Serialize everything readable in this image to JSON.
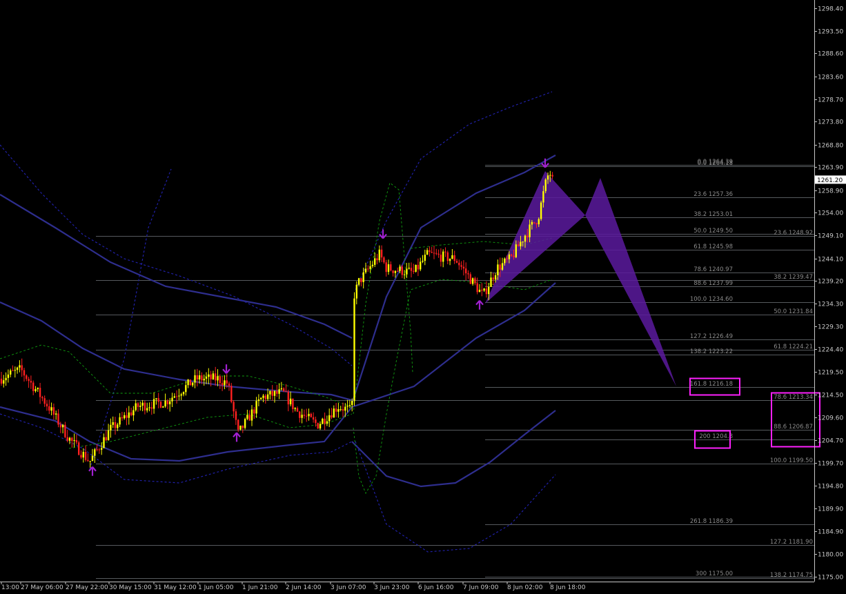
{
  "colors": {
    "background": "#000000",
    "axis": "#c8c8c8",
    "text": "#c8c8c8",
    "fib_line": "#9aa0a8",
    "fib_text": "#8a8a8a",
    "bull_candle": "#ffff00",
    "bear_candle": "#ff2020",
    "band_solid": "#2e2e8e",
    "band_dotted": "#2020a8",
    "band_green": "#10a010",
    "pattern": "#5a1a9e",
    "arrow_up": "#a020d0",
    "arrow_down": "#a020d0",
    "highlight_box": "#ff20ff",
    "price_box_bg": "#ffffff",
    "price_box_text": "#000000"
  },
  "chart_data": {
    "type": "candlestick",
    "ylim": [
      1175.0,
      1300.0
    ],
    "price_ticks": [
      "1298.40",
      "1293.50",
      "1288.60",
      "1283.60",
      "1278.70",
      "1273.80",
      "1268.80",
      "1263.90",
      "1258.90",
      "1254.00",
      "1249.10",
      "1244.10",
      "1239.20",
      "1234.30",
      "1229.30",
      "1224.40",
      "1219.50",
      "1214.50",
      "1209.60",
      "1204.70",
      "1199.70",
      "1194.80",
      "1189.90",
      "1184.90",
      "1180.00",
      "1175.00"
    ],
    "current_price": "1261.20",
    "time_labels": [
      "13:00",
      "27 May 06:00",
      "27 May 22:00",
      "30 May 15:00",
      "31 May 12:00",
      "1 Jun 05:00",
      "1 Jun 21:00",
      "2 Jun 14:00",
      "3 Jun 07:00",
      "3 Jun 23:00",
      "6 Jun 16:00",
      "7 Jun 09:00",
      "8 Jun 02:00",
      "8 Jun 18:00"
    ],
    "fib_levels": [
      {
        "label": "0.0 1264.39",
        "price": 1264.39,
        "x_start": "8 Jun 02:00",
        "x_end": "right"
      },
      {
        "label": "0.0 1264.18",
        "price": 1264.18,
        "x_start": "8 Jun 02:00",
        "x_end": "right"
      },
      {
        "label": "23.6 1257.36",
        "price": 1257.36,
        "x_start": "8 Jun 02:00",
        "x_end": "right"
      },
      {
        "label": "38.2 1253.01",
        "price": 1253.01,
        "x_start": "8 Jun 02:00",
        "x_end": "right"
      },
      {
        "label": "50.0 1249.50",
        "price": 1249.5,
        "x_start": "8 Jun 02:00",
        "x_end": "right"
      },
      {
        "label": "23.6 1248.92",
        "price": 1248.92,
        "x_start": "28 May",
        "x_end": "right"
      },
      {
        "label": "61.8 1245.98",
        "price": 1245.98,
        "x_start": "8 Jun 02:00",
        "x_end": "right"
      },
      {
        "label": "78.6 1240.97",
        "price": 1240.97,
        "x_start": "8 Jun 02:00",
        "x_end": "right"
      },
      {
        "label": "38.2 1239.47",
        "price": 1239.47,
        "x_start": "28 May",
        "x_end": "right"
      },
      {
        "label": "88.6 1237.99",
        "price": 1237.99,
        "x_start": "8 Jun 02:00",
        "x_end": "right"
      },
      {
        "label": "100.0 1234.60",
        "price": 1234.6,
        "x_start": "8 Jun 02:00",
        "x_end": "right"
      },
      {
        "label": "50.0 1231.84",
        "price": 1231.84,
        "x_start": "28 May",
        "x_end": "right"
      },
      {
        "label": "127.2 1226.49",
        "price": 1226.49,
        "x_start": "8 Jun 02:00",
        "x_end": "right"
      },
      {
        "label": "61.8 1224.21",
        "price": 1224.21,
        "x_start": "28 May",
        "x_end": "right"
      },
      {
        "label": "138.2 1223.22",
        "price": 1223.22,
        "x_start": "8 Jun 02:00",
        "x_end": "right"
      },
      {
        "label": "161.8 1216.18",
        "price": 1216.18,
        "x_start": "8 Jun 02:00",
        "x_end": "right"
      },
      {
        "label": "78.6 1213.34",
        "price": 1213.34,
        "x_start": "28 May",
        "x_end": "right"
      },
      {
        "label": "88.6 1206.87",
        "price": 1206.87,
        "x_start": "28 May",
        "x_end": "right"
      },
      {
        "label": "200 1204.8",
        "price": 1204.8,
        "x_start": "8 Jun 02:00",
        "x_end": "right"
      },
      {
        "label": "100.0 1199.50",
        "price": 1199.5,
        "x_start": "28 May",
        "x_end": "right"
      },
      {
        "label": "261.8 1186.39",
        "price": 1186.39,
        "x_start": "8 Jun 02:00",
        "x_end": "right"
      },
      {
        "label": "127.2 1181.90",
        "price": 1181.9,
        "x_start": "28 May",
        "x_end": "right"
      },
      {
        "label": "300 1175.00",
        "price": 1175.0,
        "x_start": "8 Jun 02:00",
        "x_end": "right"
      },
      {
        "label": "138.2 1174.75",
        "price": 1174.75,
        "x_start": "28 May",
        "x_end": "right"
      }
    ],
    "highlighted_levels": [
      "161.8 1216.18",
      "200 1204.8",
      "78.6 1213.34",
      "88.6 1206.87"
    ],
    "harmonic_pattern": {
      "points": [
        {
          "time": "7 Jun 09:00",
          "price": 1234.6
        },
        {
          "time": "8 Jun 18:00",
          "price": 1263.5
        },
        {
          "time": "8 Jun 20:00",
          "price": 1253.8
        },
        {
          "time": "projected",
          "price": 1260.0
        },
        {
          "time": "projected",
          "price": 1217.0
        }
      ]
    },
    "arrows": [
      {
        "type": "up",
        "time": "27 May 22:00",
        "price": 1197.8
      },
      {
        "type": "down",
        "time": "1 Jun 05:00",
        "price": 1220.2
      },
      {
        "type": "up",
        "time": "1 Jun 05:00",
        "price": 1205.2
      },
      {
        "type": "down",
        "time": "3 Jun 23:00",
        "price": 1249.5
      },
      {
        "type": "up",
        "time": "7 Jun 09:00",
        "price": 1233.9
      },
      {
        "type": "down",
        "time": "8 Jun 18:00",
        "price": 1264.9
      }
    ]
  }
}
